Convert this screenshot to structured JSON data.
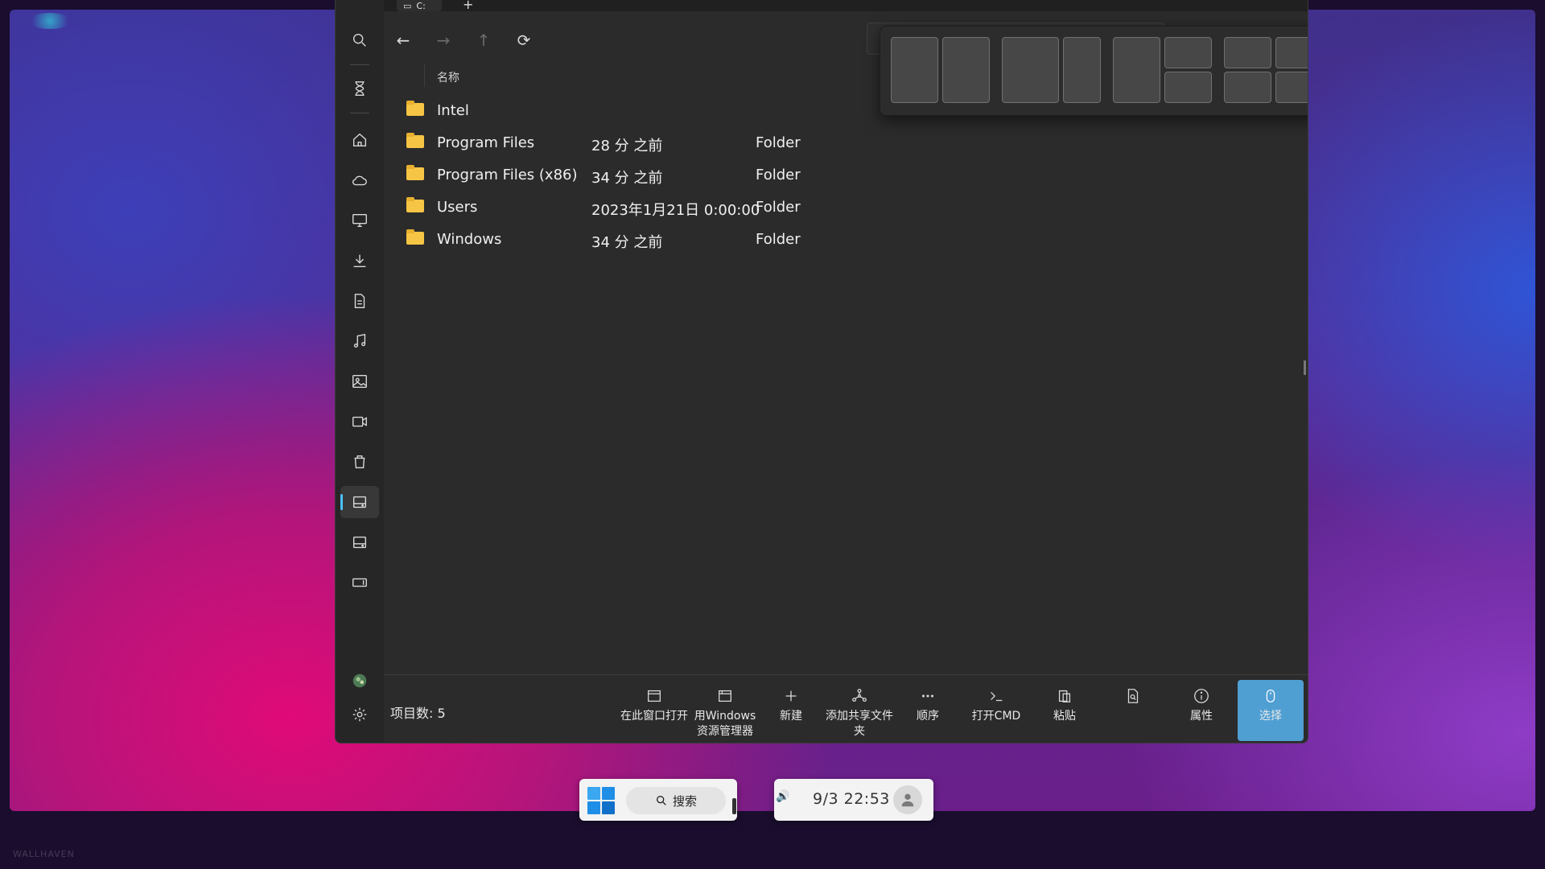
{
  "window": {
    "tab_label": "C:",
    "new_tab_glyph": "+",
    "menu_glyph": "≡"
  },
  "toolbar": {
    "back_glyph": "←",
    "forward_glyph": "→",
    "up_glyph": "↑",
    "refresh_glyph": "⟳",
    "dropdown_glyph": "⌵"
  },
  "columns": {
    "name_header": "名称"
  },
  "files": [
    {
      "name": "Intel",
      "date": "",
      "type": ""
    },
    {
      "name": "Program Files",
      "date": "28 分 之前",
      "type": "Folder"
    },
    {
      "name": "Program Files (x86)",
      "date": "34 分 之前",
      "type": "Folder"
    },
    {
      "name": "Users",
      "date": "2023年1月21日 0:00:00",
      "type": "Folder"
    },
    {
      "name": "Windows",
      "date": "34 分 之前",
      "type": "Folder"
    }
  ],
  "status": {
    "item_count": "项目数: 5"
  },
  "commands": [
    {
      "id": "open-here",
      "label": "在此窗口打开",
      "icon": "window-icon"
    },
    {
      "id": "open-explorer",
      "label": "用Windows资源管理器",
      "icon": "explorer-window-icon"
    },
    {
      "id": "new",
      "label": "新建",
      "icon": "plus-icon"
    },
    {
      "id": "share-folder",
      "label": "添加共享文件夹",
      "icon": "share-nodes-icon"
    },
    {
      "id": "sort",
      "label": "顺序",
      "icon": "more-dots-icon"
    },
    {
      "id": "open-cmd",
      "label": "打开CMD",
      "icon": "terminal-icon"
    },
    {
      "id": "paste",
      "label": "粘贴",
      "icon": "paste-icon"
    },
    {
      "id": "preview",
      "label": "",
      "icon": "file-search-icon"
    },
    {
      "id": "properties",
      "label": "属性",
      "icon": "info-icon"
    },
    {
      "id": "select",
      "label": "选择",
      "icon": "mouse-icon"
    }
  ],
  "taskbar": {
    "search_label": "搜索",
    "datetime": "9/3  22:53",
    "volume_glyph": "🔊"
  },
  "watermark": "WALLHAVEN",
  "colors": {
    "accent": "#4cc2ff",
    "select_button": "#4f9fd3",
    "folder": "#f6c545",
    "window_bg": "#2b2b2b"
  }
}
